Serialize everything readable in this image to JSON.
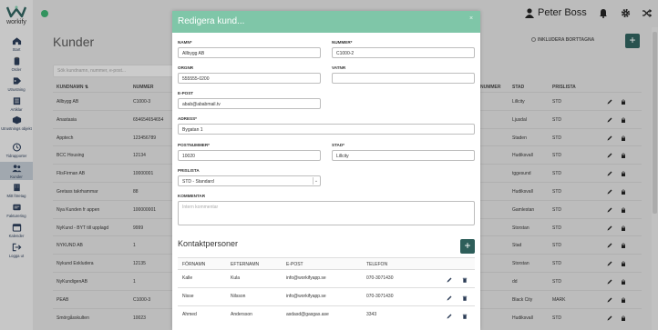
{
  "app": {
    "logo_text": "workify"
  },
  "sidebar": {
    "items": [
      {
        "label": "Start",
        "icon": "home-icon"
      },
      {
        "label": "Order",
        "icon": "clipboard-icon"
      },
      {
        "label": "Utrustning",
        "icon": "tag-icon"
      },
      {
        "label": "Artiklar",
        "icon": "list-icon"
      },
      {
        "label": "Utrustnings objekt",
        "icon": "box-icon"
      },
      {
        "label": "Tidrapporter",
        "icon": "clock-icon"
      },
      {
        "label": "Kunder",
        "icon": "people-icon"
      },
      {
        "label": "Mitt företag",
        "icon": "building-icon"
      },
      {
        "label": "Fakturering",
        "icon": "invoice-icon"
      },
      {
        "label": "Kalender",
        "icon": "calendar-icon"
      },
      {
        "label": "Logga ut",
        "icon": "logout-icon"
      }
    ]
  },
  "header": {
    "user": "Peter Boss"
  },
  "page": {
    "title": "Kunder",
    "search_placeholder": "Sök kundnamn, nummer, e-post...",
    "include_deleted": "INKLUDERA BORTTAGNA",
    "columns": {
      "name": "KUNDNAMN ⇅",
      "number": "NUMMER",
      "number2": "NUMMER",
      "city": "STAD",
      "pricelist": "PRISLISTA"
    },
    "rows": [
      {
        "name": "Allbygg AB",
        "number": "C1000-3",
        "number2": "",
        "city": "Lillcity",
        "pricelist": "STD"
      },
      {
        "name": "Anastasia",
        "number": "654654654654",
        "number2": "",
        "city": "Ljusdal",
        "pricelist": "STD"
      },
      {
        "name": "Apptech",
        "number": "123456789",
        "number2": "",
        "city": "Staden",
        "pricelist": "STD"
      },
      {
        "name": "BCC Housing",
        "number": "12134",
        "number2": "",
        "city": "Hudiksvall",
        "pricelist": "STD"
      },
      {
        "name": "FlisFirman AB",
        "number": "10000001",
        "number2": "",
        "city": "tggesund",
        "pricelist": "STD"
      },
      {
        "name": "Gretass takrhammar",
        "number": "88",
        "number2": "",
        "city": "Hudiksvall",
        "pricelist": "STD"
      },
      {
        "name": "Nya Kunden fr appen",
        "number": "100000001",
        "number2": "",
        "city": "Gamlestan",
        "pricelist": "STD"
      },
      {
        "name": "NyKund - BYT till upplagd",
        "number": "9999",
        "number2": "",
        "city": "Storstan",
        "pricelist": "STD"
      },
      {
        "name": "NYKUND AB",
        "number": "1",
        "number2": "",
        "city": "Stad",
        "pricelist": "STD"
      },
      {
        "name": "Nykund Exkludera",
        "number": "12135",
        "number2": "",
        "city": "Storstan",
        "pricelist": "STD"
      },
      {
        "name": "NyKundigenAB",
        "number": "1",
        "number2": "",
        "city": "dd",
        "pricelist": "STD"
      },
      {
        "name": "PEAB",
        "number": "C1000-3",
        "number2": "",
        "city": "Black City",
        "pricelist": "MARK"
      },
      {
        "name": "Smörgåsskulten",
        "number": "10023",
        "number2": "",
        "city": "Hudiksvall",
        "pricelist": "STD"
      }
    ]
  },
  "modal": {
    "title": "Redigera kund...",
    "close": "×",
    "fields": {
      "name_label": "NAMN*",
      "name_value": "Allbygg AB",
      "number_label": "NUMMER*",
      "number_value": "C1000-2",
      "orgnr_label": "ORGNR",
      "orgnr_value": "555555-0200",
      "vatnr_label": "VATNR",
      "vatnr_value": "",
      "email_label": "E-POST",
      "email_value": "abab@ababmail.tv",
      "address_label": "ADRESS*",
      "address_value": "Bygatan 1",
      "postal_label": "POSTNUMMER*",
      "postal_value": "10020",
      "city_label": "STAD*",
      "city_value": "Lillcity",
      "pricelist_label": "PRISLISTA",
      "pricelist_value": "STD - Standard",
      "comment_label": "KOMMENTAR",
      "comment_placeholder": "Intern kommentar"
    },
    "contacts": {
      "title": "Kontaktpersoner",
      "add": "+",
      "columns": {
        "first": "FÖRNAMN",
        "last": "EFTERNAMN",
        "email": "E-POST",
        "phone": "TELEFON"
      },
      "rows": [
        {
          "first": "Kalle",
          "last": "Kula",
          "email": "info@workifyapp.se",
          "phone": "070-3071430"
        },
        {
          "first": "Nisse",
          "last": "Nilsson",
          "email": "info@workifyapp.se",
          "phone": "070-3071430"
        },
        {
          "first": "Ahmed",
          "last": "Andersson",
          "email": "asdasd@gasgas.ase",
          "phone": "3343"
        }
      ]
    }
  },
  "colors": {
    "accent": "#2e5e5a",
    "modal_header": "#7fc6a8",
    "online": "#3aa86b"
  }
}
